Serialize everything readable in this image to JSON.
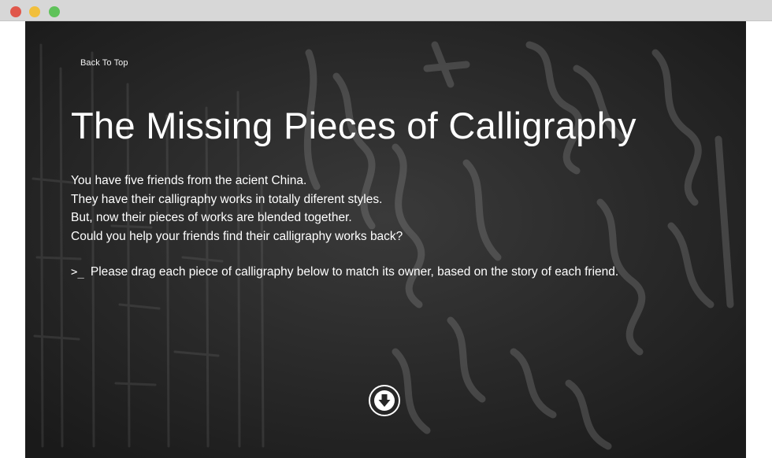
{
  "window": {
    "controls": [
      "close",
      "minimize",
      "maximize"
    ]
  },
  "nav": {
    "back_to_top": "Back To Top"
  },
  "hero": {
    "title": "The Missing Pieces of Calligraphy",
    "intro_lines": [
      "You have five friends from the acient China.",
      "They have their calligraphy works in totally diferent styles.",
      "But, now their pieces of works are blended together.",
      "Could you help your friends find their calligraphy works back?"
    ],
    "instruction_prompt": ">_",
    "instruction": "Please drag each piece of calligraphy below to match its owner, based on the story of each friend.",
    "scroll_icon": "arrow-down-circle-icon"
  },
  "colors": {
    "background": "#262626",
    "text": "#ffffff",
    "close": "#e0574b",
    "minimize": "#f1bf3c",
    "maximize": "#5fc25a"
  }
}
